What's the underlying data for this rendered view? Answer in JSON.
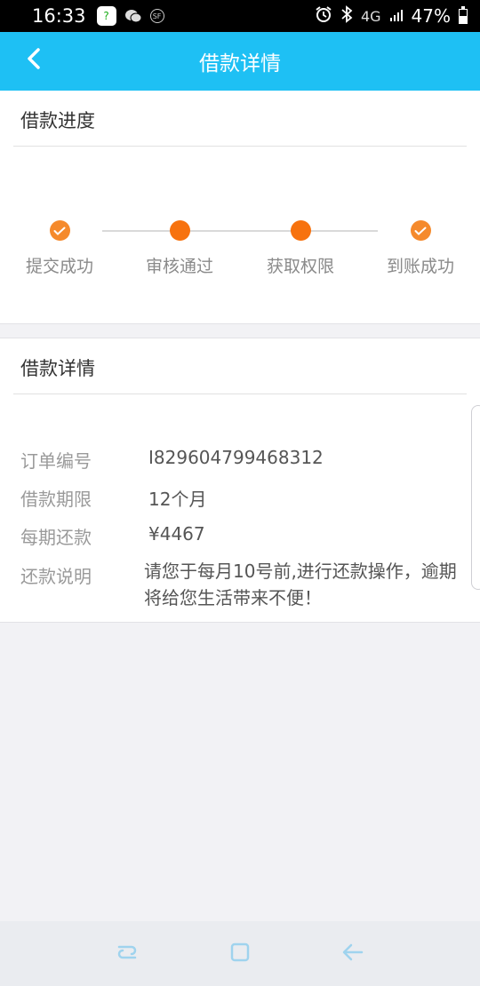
{
  "status_bar": {
    "time": "16:33",
    "network": "4G",
    "battery": "47%",
    "battery_level": 0.47
  },
  "header": {
    "title": "借款详情",
    "back_icon": "chevron-left-icon"
  },
  "progress": {
    "title": "借款进度",
    "steps": [
      {
        "label": "提交成功",
        "state": "done"
      },
      {
        "label": "审核通过",
        "state": "dot"
      },
      {
        "label": "获取权限",
        "state": "dot"
      },
      {
        "label": "到账成功",
        "state": "done"
      }
    ],
    "accent_color": "#f7720e"
  },
  "detail": {
    "title": "借款详情",
    "rows": [
      {
        "key": "订单编号",
        "value": "I829604799468312"
      },
      {
        "key": "借款期限",
        "value": "12个月"
      },
      {
        "key": "每期还款",
        "value": "¥4467"
      },
      {
        "key": "还款说明",
        "value": "请您于每月10号前,进行还款操作，逾期将给您生活带来不便！"
      }
    ]
  },
  "theme": {
    "header_color": "#1ec0f4",
    "background": "#f2f2f5"
  },
  "nav_bar": {
    "icons": [
      "recent-apps-icon",
      "home-icon",
      "back-icon"
    ]
  }
}
